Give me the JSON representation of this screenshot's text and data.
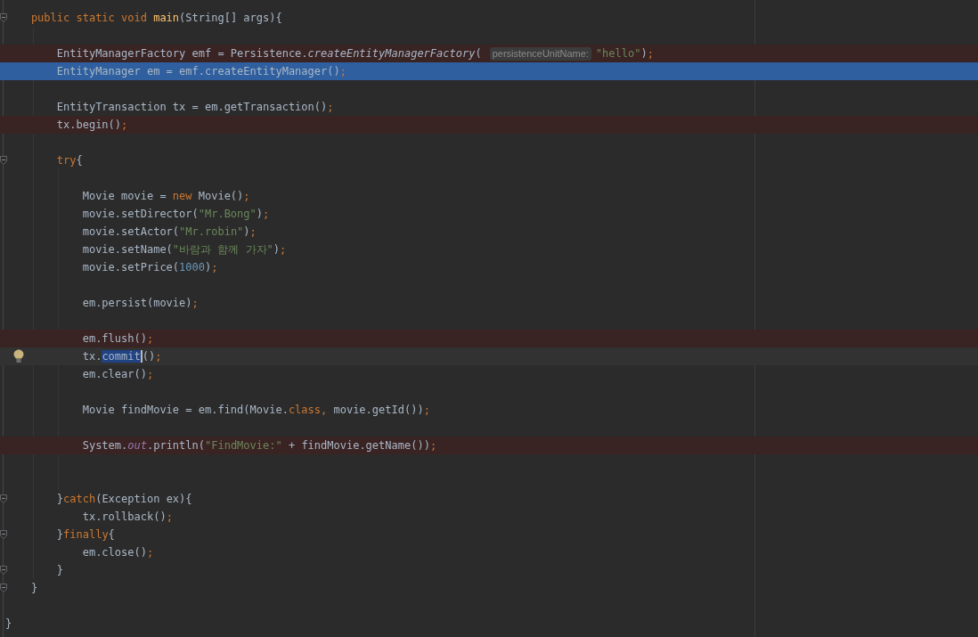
{
  "lines": [
    {
      "error": false,
      "selected": false,
      "current": false,
      "fold": true,
      "bulb": false,
      "segments": [
        {
          "kind": "code",
          "tokens": [
            {
              "kind": "keyword",
              "text": "    public static void "
            },
            {
              "kind": "method",
              "text": "main"
            },
            {
              "kind": "plain",
              "text": "(String[] args){"
            }
          ]
        }
      ]
    },
    {
      "error": false,
      "selected": false,
      "current": false,
      "fold": false,
      "bulb": false
    },
    {
      "error": true,
      "selected": false,
      "current": false,
      "fold": false,
      "bulb": false,
      "segments": [
        {
          "kind": "code",
          "tokens": [
            {
              "kind": "plain",
              "text": "        EntityManagerFactory emf = Persistence."
            },
            {
              "kind": "static-call",
              "text": "createEntityManagerFactory"
            },
            {
              "kind": "plain",
              "text": "("
            }
          ]
        },
        {
          "kind": "hint",
          "text": "persistenceUnitName:"
        },
        {
          "kind": "code",
          "tokens": [
            {
              "kind": "string",
              "text": "\"hello\""
            },
            {
              "kind": "plain",
              "text": ")"
            },
            {
              "kind": "keyword",
              "text": ";"
            }
          ]
        }
      ]
    },
    {
      "error": false,
      "selected": true,
      "current": false,
      "fold": false,
      "bulb": false,
      "segments": [
        {
          "kind": "code",
          "tokens": [
            {
              "kind": "plain",
              "text": "        EntityManager em = emf.createEntityManager()"
            },
            {
              "kind": "keyword",
              "text": ";"
            }
          ]
        }
      ]
    },
    {
      "error": false,
      "selected": false,
      "current": false,
      "fold": false,
      "bulb": false
    },
    {
      "error": false,
      "selected": false,
      "current": false,
      "fold": false,
      "bulb": false,
      "segments": [
        {
          "kind": "code",
          "tokens": [
            {
              "kind": "plain",
              "text": "        EntityTransaction tx = em.getTransaction()"
            },
            {
              "kind": "keyword",
              "text": ";"
            }
          ]
        }
      ]
    },
    {
      "error": true,
      "selected": false,
      "current": false,
      "fold": false,
      "bulb": false,
      "segments": [
        {
          "kind": "code",
          "tokens": [
            {
              "kind": "plain",
              "text": "        tx.begin()"
            },
            {
              "kind": "keyword",
              "text": ";"
            }
          ]
        }
      ]
    },
    {
      "error": false,
      "selected": false,
      "current": false,
      "fold": false,
      "bulb": false
    },
    {
      "error": false,
      "selected": false,
      "current": false,
      "fold": true,
      "bulb": false,
      "segments": [
        {
          "kind": "code",
          "tokens": [
            {
              "kind": "keyword",
              "text": "        try"
            },
            {
              "kind": "plain",
              "text": "{"
            }
          ]
        }
      ]
    },
    {
      "error": false,
      "selected": false,
      "current": false,
      "fold": false,
      "bulb": false
    },
    {
      "error": false,
      "selected": false,
      "current": false,
      "fold": false,
      "bulb": false,
      "segments": [
        {
          "kind": "code",
          "tokens": [
            {
              "kind": "plain",
              "text": "            Movie movie = "
            },
            {
              "kind": "keyword",
              "text": "new "
            },
            {
              "kind": "plain",
              "text": "Movie()"
            },
            {
              "kind": "keyword",
              "text": ";"
            }
          ]
        }
      ]
    },
    {
      "error": false,
      "selected": false,
      "current": false,
      "fold": false,
      "bulb": false,
      "segments": [
        {
          "kind": "code",
          "tokens": [
            {
              "kind": "plain",
              "text": "            movie.setDirector("
            },
            {
              "kind": "string",
              "text": "\"Mr.Bong\""
            },
            {
              "kind": "plain",
              "text": ")"
            },
            {
              "kind": "keyword",
              "text": ";"
            }
          ]
        }
      ]
    },
    {
      "error": false,
      "selected": false,
      "current": false,
      "fold": false,
      "bulb": false,
      "segments": [
        {
          "kind": "code",
          "tokens": [
            {
              "kind": "plain",
              "text": "            movie.setActor("
            },
            {
              "kind": "string",
              "text": "\"Mr.robin\""
            },
            {
              "kind": "plain",
              "text": ")"
            },
            {
              "kind": "keyword",
              "text": ";"
            }
          ]
        }
      ]
    },
    {
      "error": false,
      "selected": false,
      "current": false,
      "fold": false,
      "bulb": false,
      "segments": [
        {
          "kind": "code",
          "tokens": [
            {
              "kind": "plain",
              "text": "            movie.setName("
            },
            {
              "kind": "string",
              "text": "\"바람과 함께 가자\""
            },
            {
              "kind": "plain",
              "text": ")"
            },
            {
              "kind": "keyword",
              "text": ";"
            }
          ]
        }
      ]
    },
    {
      "error": false,
      "selected": false,
      "current": false,
      "fold": false,
      "bulb": false,
      "segments": [
        {
          "kind": "code",
          "tokens": [
            {
              "kind": "plain",
              "text": "            movie.setPrice("
            },
            {
              "kind": "number",
              "text": "1000"
            },
            {
              "kind": "plain",
              "text": ")"
            },
            {
              "kind": "keyword",
              "text": ";"
            }
          ]
        }
      ]
    },
    {
      "error": false,
      "selected": false,
      "current": false,
      "fold": false,
      "bulb": false
    },
    {
      "error": false,
      "selected": false,
      "current": false,
      "fold": false,
      "bulb": false,
      "segments": [
        {
          "kind": "code",
          "tokens": [
            {
              "kind": "plain",
              "text": "            em.persist(movie)"
            },
            {
              "kind": "keyword",
              "text": ";"
            }
          ]
        }
      ]
    },
    {
      "error": false,
      "selected": false,
      "current": false,
      "fold": false,
      "bulb": false
    },
    {
      "error": true,
      "selected": false,
      "current": false,
      "fold": false,
      "bulb": false,
      "segments": [
        {
          "kind": "code",
          "tokens": [
            {
              "kind": "plain",
              "text": "            em.flush()"
            },
            {
              "kind": "keyword",
              "text": ";"
            }
          ]
        }
      ]
    },
    {
      "error": false,
      "selected": false,
      "current": true,
      "fold": false,
      "bulb": true,
      "segments": [
        {
          "kind": "code",
          "tokens": [
            {
              "kind": "plain",
              "text": "            tx."
            },
            {
              "kind": "selected",
              "text": "commit"
            },
            {
              "kind": "plain",
              "text": "()"
            },
            {
              "kind": "keyword",
              "text": ";"
            }
          ]
        }
      ]
    },
    {
      "error": false,
      "selected": false,
      "current": false,
      "fold": false,
      "bulb": false,
      "segments": [
        {
          "kind": "code",
          "tokens": [
            {
              "kind": "plain",
              "text": "            em.clear()"
            },
            {
              "kind": "keyword",
              "text": ";"
            }
          ]
        }
      ]
    },
    {
      "error": false,
      "selected": false,
      "current": false,
      "fold": false,
      "bulb": false
    },
    {
      "error": false,
      "selected": false,
      "current": false,
      "fold": false,
      "bulb": false,
      "segments": [
        {
          "kind": "code",
          "tokens": [
            {
              "kind": "plain",
              "text": "            Movie findMovie = em.find(Movie."
            },
            {
              "kind": "keyword",
              "text": "class, "
            },
            {
              "kind": "plain",
              "text": "movie.getId())"
            },
            {
              "kind": "keyword",
              "text": ";"
            }
          ]
        }
      ]
    },
    {
      "error": false,
      "selected": false,
      "current": false,
      "fold": false,
      "bulb": false
    },
    {
      "error": true,
      "selected": false,
      "current": false,
      "fold": false,
      "bulb": false,
      "segments": [
        {
          "kind": "code",
          "tokens": [
            {
              "kind": "plain",
              "text": "            System."
            },
            {
              "kind": "static-field",
              "text": "out"
            },
            {
              "kind": "plain",
              "text": ".println("
            },
            {
              "kind": "string",
              "text": "\"FindMovie:\""
            },
            {
              "kind": "plain",
              "text": " + findMovie.getName())"
            },
            {
              "kind": "keyword",
              "text": ";"
            }
          ]
        }
      ]
    },
    {
      "error": false,
      "selected": false,
      "current": false,
      "fold": false,
      "bulb": false
    },
    {
      "error": false,
      "selected": false,
      "current": false,
      "fold": false,
      "bulb": false
    },
    {
      "error": false,
      "selected": false,
      "current": false,
      "fold": true,
      "bulb": false,
      "segments": [
        {
          "kind": "code",
          "tokens": [
            {
              "kind": "plain",
              "text": "        }"
            },
            {
              "kind": "keyword",
              "text": "catch"
            },
            {
              "kind": "plain",
              "text": "(Exception ex){"
            }
          ]
        }
      ]
    },
    {
      "error": false,
      "selected": false,
      "current": false,
      "fold": false,
      "bulb": false,
      "segments": [
        {
          "kind": "code",
          "tokens": [
            {
              "kind": "plain",
              "text": "            tx.rollback()"
            },
            {
              "kind": "keyword",
              "text": ";"
            }
          ]
        }
      ]
    },
    {
      "error": false,
      "selected": false,
      "current": false,
      "fold": true,
      "bulb": false,
      "segments": [
        {
          "kind": "code",
          "tokens": [
            {
              "kind": "plain",
              "text": "        }"
            },
            {
              "kind": "keyword",
              "text": "finally"
            },
            {
              "kind": "plain",
              "text": "{"
            }
          ]
        }
      ]
    },
    {
      "error": false,
      "selected": false,
      "current": false,
      "fold": false,
      "bulb": false,
      "segments": [
        {
          "kind": "code",
          "tokens": [
            {
              "kind": "plain",
              "text": "            em.close()"
            },
            {
              "kind": "keyword",
              "text": ";"
            }
          ]
        }
      ]
    },
    {
      "error": false,
      "selected": false,
      "current": false,
      "fold": true,
      "bulb": false,
      "segments": [
        {
          "kind": "code",
          "tokens": [
            {
              "kind": "plain",
              "text": "        }"
            }
          ]
        }
      ]
    },
    {
      "error": false,
      "selected": false,
      "current": false,
      "fold": true,
      "bulb": false,
      "segments": [
        {
          "kind": "code",
          "tokens": [
            {
              "kind": "plain",
              "text": "    }"
            }
          ]
        }
      ]
    },
    {
      "error": false,
      "selected": false,
      "current": false,
      "fold": false,
      "bulb": false
    },
    {
      "error": false,
      "selected": false,
      "current": false,
      "fold": false,
      "bulb": false,
      "segments": [
        {
          "kind": "code",
          "tokens": [
            {
              "kind": "plain",
              "text": "}"
            }
          ]
        }
      ]
    }
  ]
}
